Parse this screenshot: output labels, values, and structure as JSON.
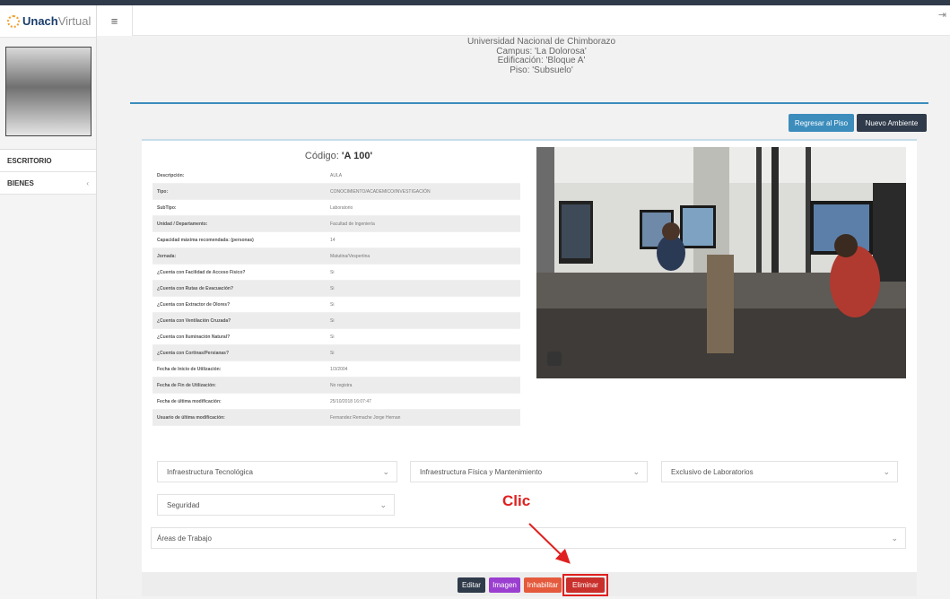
{
  "brand": {
    "part1": "Unach",
    "part2": "Virtual"
  },
  "nav": {
    "menu_icon": "≡",
    "items": [
      {
        "label": "ESCRITORIO"
      },
      {
        "label": "BIENES",
        "chevron": "‹"
      }
    ],
    "logout_icon": "⇥"
  },
  "header": {
    "line1": "Universidad Nacional de Chimborazo",
    "line2": "Campus: 'La Dolorosa'",
    "line3": "Edificación: 'Bloque A'",
    "line4": "Piso: 'Subsuelo'"
  },
  "actions": {
    "back": "Regresar al Piso",
    "new": "Nuevo Ambiente"
  },
  "room": {
    "codigo_label": "Código:",
    "codigo_value": "'A 100'",
    "details": [
      {
        "k": "Descripción:",
        "v": "AULA"
      },
      {
        "k": "Tipo:",
        "v": "CONOCIMIENTO/ACADEMICO/INVESTIGACIÓN"
      },
      {
        "k": "SubTipo:",
        "v": "Laboratorio"
      },
      {
        "k": "Unidad / Departamento:",
        "v": "Facultad de Ingeniería"
      },
      {
        "k": "Capacidad máxima recomendada: (personas)",
        "v": "14"
      },
      {
        "k": "Jornada:",
        "v": "Matutina/Vespertina"
      },
      {
        "k": "¿Cuenta con Facilidad de Acceso Físico?",
        "v": "Si"
      },
      {
        "k": "¿Cuenta con Rutas de Evacuación?",
        "v": "Si"
      },
      {
        "k": "¿Cuenta con Extractor de Olores?",
        "v": "Si"
      },
      {
        "k": "¿Cuenta con Ventilación Cruzada?",
        "v": "Si"
      },
      {
        "k": "¿Cuenta con Iluminación Natural?",
        "v": "Si"
      },
      {
        "k": "¿Cuenta con Cortinas/Persianas?",
        "v": "Si"
      },
      {
        "k": "Fecha de Inicio de Utilización:",
        "v": "1/3/2004"
      },
      {
        "k": "Fecha de Fin de Utilización:",
        "v": "No registra"
      },
      {
        "k": "Fecha de última modificación:",
        "v": "25/10/2018 16:07:47"
      },
      {
        "k": "Usuario de última modificación:",
        "v": "Fernandez Remache Jorge Hernan"
      }
    ]
  },
  "sections": {
    "infra_tec": "Infraestructura Tecnológica",
    "infra_fis": "Infraestructura Física y Mantenimiento",
    "labs": "Exclusivo de Laboratorios",
    "seguridad": "Seguridad",
    "areas": "Áreas de Trabajo"
  },
  "annotation": {
    "text": "Clic"
  },
  "footer": {
    "edit": "Editar",
    "image": "Imagen",
    "disable": "Inhabilitar",
    "delete": "Eliminar"
  },
  "colors": {
    "accent": "#3c8dbc",
    "dark": "#2f3a4a",
    "purple": "#9b3fd0",
    "orange": "#e55a3c",
    "red": "#c9302c",
    "highlight": "#e02020"
  }
}
